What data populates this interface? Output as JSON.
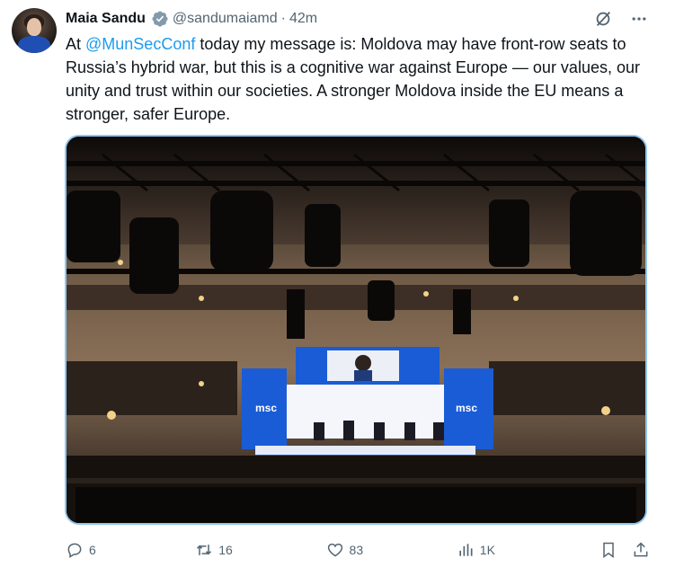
{
  "tweet": {
    "author_name": "Maia Sandu",
    "handle": "@sandumaiamd",
    "separator": "·",
    "time": "42m",
    "text_prefix": "At ",
    "mention": "@MunSecConf",
    "text_rest": " today my message is: Moldova may have front-row seats to Russia’s hybrid war, but this is a cognitive war against Europe — our values, our unity and trust within our societies. A stronger Moldova inside the EU means a stronger, safer Europe."
  },
  "media": {
    "stage_logo_left": "msc",
    "stage_logo_right": "msc"
  },
  "stats": {
    "replies": "6",
    "reposts": "16",
    "likes": "83",
    "views": "1K"
  },
  "icons": {
    "verified": "verified-badge-icon",
    "grok": "grok-icon",
    "more": "more-icon",
    "reply": "reply-icon",
    "repost": "repost-icon",
    "like": "heart-icon",
    "views": "views-icon",
    "bookmark": "bookmark-icon",
    "share": "share-icon"
  },
  "colors": {
    "accent": "#1d9bf0",
    "muted": "#536471",
    "stage_blue": "#1a5cd6"
  }
}
